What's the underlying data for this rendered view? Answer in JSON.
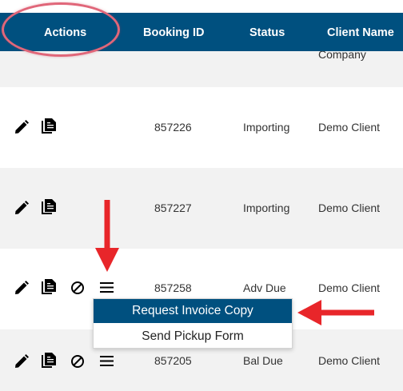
{
  "table": {
    "headers": {
      "actions": "Actions",
      "booking_id": "Booking ID",
      "status": "Status",
      "client_name": "Client Name"
    },
    "rows": [
      {
        "booking_id": "",
        "status": "",
        "client": "Company"
      },
      {
        "booking_id": "857226",
        "status": "Importing",
        "client": "Demo Client"
      },
      {
        "booking_id": "857227",
        "status": "Importing",
        "client": "Demo Client"
      },
      {
        "booking_id": "857258",
        "status": "Adv Due",
        "client": "Demo Client"
      },
      {
        "booking_id": "857205",
        "status": "Bal Due",
        "client": "Demo Client"
      }
    ]
  },
  "dropdown": {
    "items": [
      {
        "label": "Request Invoice Copy"
      },
      {
        "label": "Send Pickup Form"
      }
    ]
  },
  "icons": {
    "edit": "pencil-icon",
    "copy": "copy-documents-icon",
    "cancel": "cancel-circle-icon",
    "menu": "hamburger-menu-icon"
  },
  "colors": {
    "header": "#00507f",
    "row_shade": "#f2f2f2",
    "annotation_red": "#e8262a",
    "oval": "#e06679"
  }
}
